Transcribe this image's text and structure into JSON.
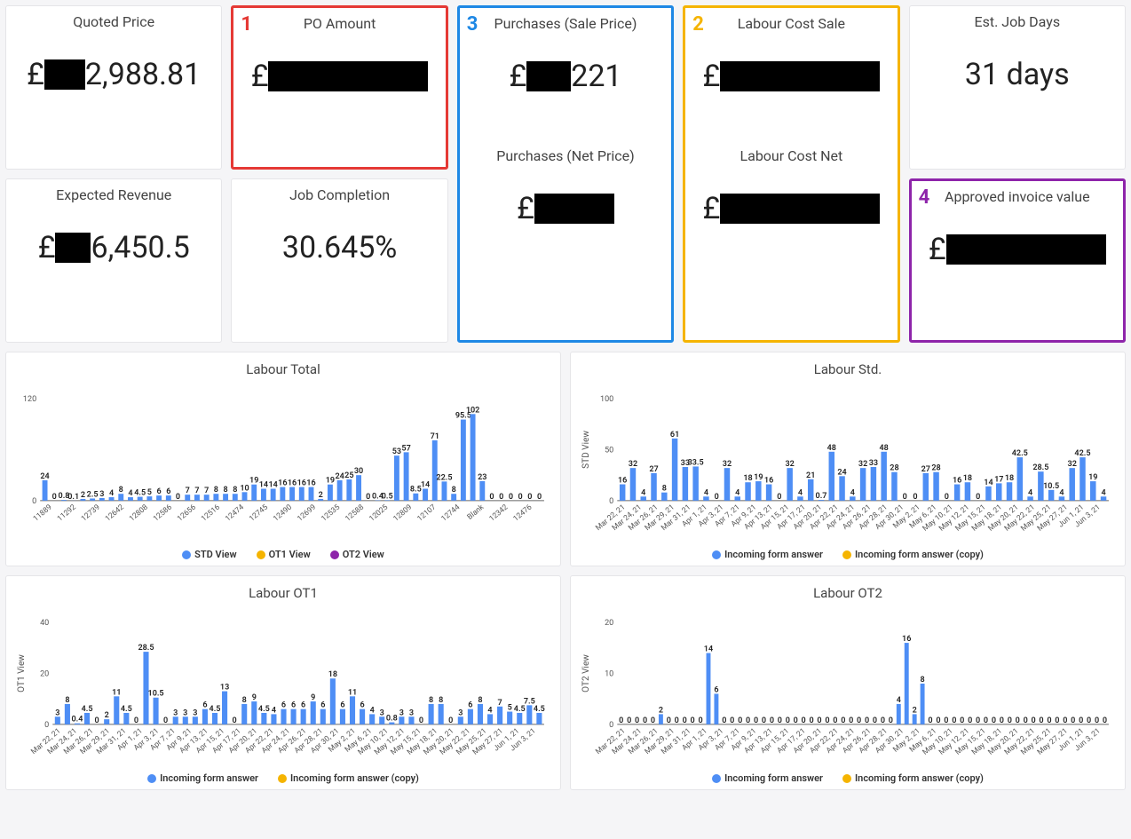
{
  "kpi": {
    "row1": [
      {
        "title": "Quoted Price",
        "prefix": "£",
        "redact_w": 46,
        "suffix": "2,988.81"
      },
      {
        "title": "PO Amount",
        "prefix": "£",
        "redact_w": 180,
        "suffix": "",
        "annot": "1",
        "annot_cls": "annot-red",
        "box_cls": "box-red"
      },
      {
        "title": "Purchases (Sale Price)",
        "prefix": "£",
        "redact_w": 50,
        "suffix": "221",
        "annot": "3",
        "annot_cls": "annot-blue",
        "box_cls": "box-blue",
        "tall": true
      },
      {
        "title": "Labour Cost Sale",
        "prefix": "£",
        "redact_w": 180,
        "suffix": "",
        "annot": "2",
        "annot_cls": "annot-gold",
        "box_cls": "box-gold",
        "tall": true
      },
      {
        "title": "Est. Job Days",
        "plain": "31 days"
      }
    ],
    "row2": [
      {
        "title": "Expected Revenue",
        "prefix": "£",
        "redact_w": 40,
        "suffix": "6,450.5"
      },
      {
        "title": "Job Completion",
        "plain": "30.645%"
      },
      {
        "title": "Purchases (Net Price)",
        "prefix": "£",
        "redact_w": 90,
        "suffix": "",
        "sub": true
      },
      {
        "title": "Labour Cost Net",
        "prefix": "£",
        "redact_w": 180,
        "suffix": "",
        "sub": true
      },
      {
        "title": "Approved invoice value",
        "prefix": "£",
        "redact_w": 180,
        "suffix": "",
        "annot": "4",
        "annot_cls": "annot-purple",
        "box_cls": "box-purple"
      }
    ]
  },
  "chart_data": [
    {
      "id": "labour_total",
      "type": "bar",
      "title": "Labour Total",
      "ylim": [
        0,
        120
      ],
      "yticks": [
        0,
        120
      ],
      "legend": [
        "STD View",
        "OT1 View",
        "OT2 View"
      ],
      "legend_colors": [
        "dot-blue",
        "dot-yellow",
        "dot-purple"
      ],
      "categories": [
        "11889",
        "11292",
        "12739",
        "12642",
        "12808",
        "12586",
        "12656",
        "12516",
        "12474",
        "12745",
        "12490",
        "12699",
        "12535",
        "12588",
        "12025",
        "12809",
        "12107",
        "12744",
        "Blank",
        "12342",
        "12476"
      ],
      "values": [
        24,
        0,
        0.8,
        0.1,
        2,
        2.5,
        3,
        4,
        8,
        4,
        4.5,
        5,
        6,
        6,
        0,
        7,
        7,
        7,
        8,
        8,
        8,
        10,
        19,
        14,
        14,
        16,
        16,
        16,
        16,
        2,
        19,
        24,
        25,
        30,
        0,
        0.4,
        0.5,
        53,
        57,
        8.5,
        14,
        71,
        22.5,
        8,
        95.5,
        102,
        23,
        0,
        0,
        0,
        0,
        0,
        0
      ]
    },
    {
      "id": "labour_std",
      "type": "bar",
      "title": "Labour Std.",
      "ylabel": "STD View",
      "ylim": [
        0,
        100
      ],
      "yticks": [
        0,
        50,
        100
      ],
      "legend": [
        "Incoming form answer",
        "Incoming form answer (copy)"
      ],
      "legend_colors": [
        "dot-blue",
        "dot-yellow"
      ],
      "categories": [
        "Mar 22, 21",
        "Mar 24, 21",
        "Mar 26, 21",
        "Mar 29, 21",
        "Mar 31, 21",
        "Apr 1, 21",
        "Apr 3, 21",
        "Apr 7, 21",
        "Apr 9, 21",
        "Apr 13, 21",
        "Apr 15, 21",
        "Apr 17, 21",
        "Apr 20, 21",
        "Apr 22, 21",
        "Apr 24, 21",
        "Apr 26, 21",
        "Apr 28, 21",
        "Apr 30, 21",
        "May 2, 21",
        "May 6, 21",
        "May 10, 21",
        "May 12, 21",
        "May 15, 21",
        "May 18, 21",
        "May 20, 21",
        "May 22, 21",
        "May 25, 21",
        "May 27, 21",
        "Jun 1, 21",
        "Jun 3, 21"
      ],
      "values": [
        16,
        32,
        4,
        27,
        8,
        61,
        33,
        33.5,
        4,
        0,
        32,
        4,
        18,
        19,
        16,
        0,
        32,
        4,
        21,
        0.7,
        48,
        24,
        4,
        32,
        33,
        48,
        28,
        0,
        0,
        27,
        28,
        0,
        16,
        18,
        0,
        14,
        17,
        18,
        42.5,
        4,
        28.5,
        10.5,
        4,
        32,
        42.5,
        19,
        4
      ]
    },
    {
      "id": "labour_ot1",
      "type": "bar",
      "title": "Labour OT1",
      "ylabel": "OT1 View",
      "ylim": [
        0,
        40
      ],
      "yticks": [
        0,
        20,
        40
      ],
      "legend": [
        "Incoming form answer",
        "Incoming form answer (copy)"
      ],
      "legend_colors": [
        "dot-blue",
        "dot-yellow"
      ],
      "categories": [
        "Mar 22, 21",
        "Mar 24, 21",
        "Mar 26, 21",
        "Mar 29, 21",
        "Mar 31, 21",
        "Apr 1, 21",
        "Apr 3, 21",
        "Apr 7, 21",
        "Apr 9, 21",
        "Apr 13, 21",
        "Apr 15, 21",
        "Apr 17, 21",
        "Apr 20, 21",
        "Apr 22, 21",
        "Apr 24, 21",
        "Apr 26, 21",
        "Apr 28, 21",
        "Apr 30, 21",
        "May 2, 21",
        "May 6, 21",
        "May 10, 21",
        "May 12, 21",
        "May 15, 21",
        "May 18, 21",
        "May 20, 21",
        "May 22, 21",
        "May 25, 21",
        "May 27, 21",
        "Jun 1, 21",
        "Jun 3, 21"
      ],
      "values": [
        3,
        8,
        0.4,
        4.5,
        0,
        2,
        11,
        4.5,
        0,
        28.5,
        10.5,
        0,
        3,
        3,
        3,
        6,
        4.5,
        13,
        0,
        8,
        9,
        4.5,
        4,
        6,
        6,
        6,
        9,
        6,
        18,
        6,
        11,
        6,
        4,
        3,
        0.8,
        3,
        3,
        0,
        8,
        8,
        0,
        3,
        6,
        8,
        4,
        7,
        5,
        4.5,
        7.5,
        4.5
      ]
    },
    {
      "id": "labour_ot2",
      "type": "bar",
      "title": "Labour OT2",
      "ylabel": "OT2 View",
      "ylim": [
        0,
        20
      ],
      "yticks": [
        0,
        10,
        20
      ],
      "legend": [
        "Incoming form answer",
        "Incoming form answer (copy)"
      ],
      "legend_colors": [
        "dot-blue",
        "dot-yellow"
      ],
      "categories": [
        "Mar 22, 21",
        "Mar 24, 21",
        "Mar 26, 21",
        "Mar 29, 21",
        "Mar 31, 21",
        "Apr 1, 21",
        "Apr 3, 21",
        "Apr 7, 21",
        "Apr 9, 21",
        "Apr 13, 21",
        "Apr 15, 21",
        "Apr 17, 21",
        "Apr 20, 21",
        "Apr 22, 21",
        "Apr 24, 21",
        "Apr 26, 21",
        "Apr 28, 21",
        "Apr 30, 21",
        "May 2, 21",
        "May 6, 21",
        "May 10, 21",
        "May 12, 21",
        "May 15, 21",
        "May 18, 21",
        "May 20, 21",
        "May 22, 21",
        "May 25, 21",
        "May 27, 21",
        "Jun 1, 21",
        "Jun 3, 21"
      ],
      "values": [
        0,
        0,
        0,
        0,
        0,
        2,
        0,
        0,
        0,
        0,
        0,
        14,
        6,
        0,
        0,
        0,
        0,
        0,
        0,
        0,
        0,
        0,
        0,
        0,
        0,
        0,
        0,
        0,
        0,
        0,
        0,
        0,
        0,
        0,
        0,
        4,
        16,
        2,
        8,
        0,
        0,
        0,
        0,
        0,
        0,
        0,
        0,
        0,
        0,
        0,
        0,
        0,
        0,
        0,
        0,
        0,
        0,
        0,
        0,
        0,
        0,
        0
      ]
    }
  ]
}
